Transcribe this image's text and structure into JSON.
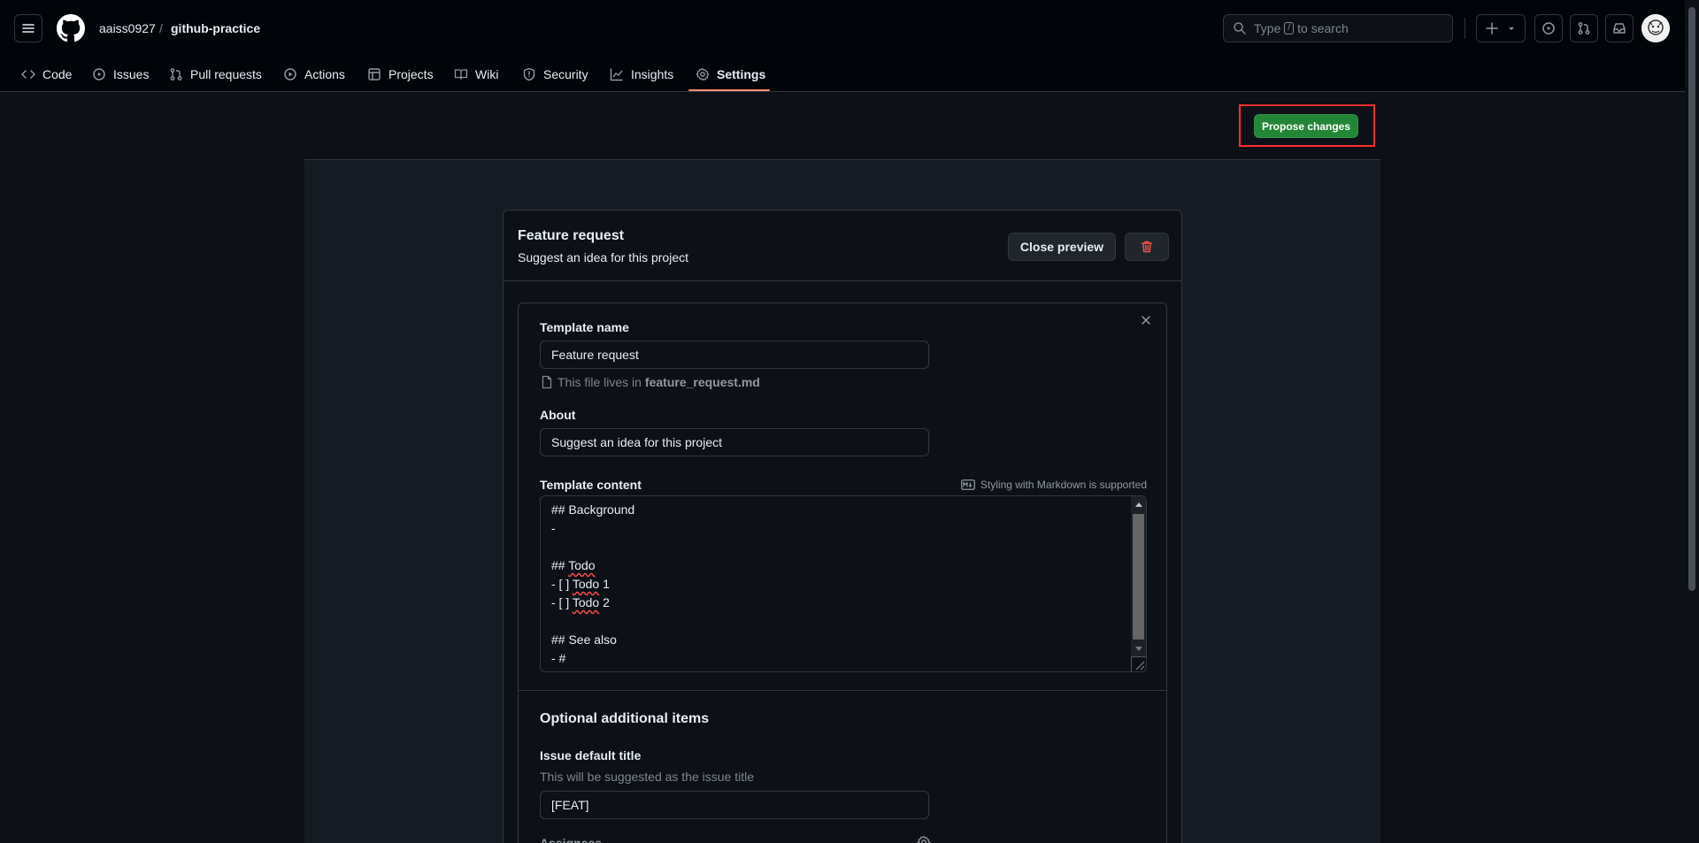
{
  "header": {
    "owner": "aaiss0927",
    "separator": "/",
    "repo": "github-practice",
    "search": {
      "before": "Type",
      "key": "/",
      "after": "to search"
    }
  },
  "nav_tabs": [
    {
      "label": "Code",
      "icon": "code-icon"
    },
    {
      "label": "Issues",
      "icon": "issue-opened-icon"
    },
    {
      "label": "Pull requests",
      "icon": "git-pull-request-icon"
    },
    {
      "label": "Actions",
      "icon": "play-icon"
    },
    {
      "label": "Projects",
      "icon": "table-icon"
    },
    {
      "label": "Wiki",
      "icon": "book-icon"
    },
    {
      "label": "Security",
      "icon": "shield-icon"
    },
    {
      "label": "Insights",
      "icon": "graph-icon"
    },
    {
      "label": "Settings",
      "icon": "gear-icon",
      "active": true
    }
  ],
  "toolbar": {
    "propose_label": "Propose changes"
  },
  "template_card": {
    "title": "Feature request",
    "description": "Suggest an idea for this project",
    "close_preview_label": "Close preview"
  },
  "form": {
    "template_name_label": "Template name",
    "template_name_value": "Feature request",
    "file_hint_prefix": "This file lives in",
    "file_name": "feature_request.md",
    "about_label": "About",
    "about_value": "Suggest an idea for this project",
    "content_label": "Template content",
    "markdown_hint": "Styling with Markdown is supported",
    "content_lines": [
      {
        "pre": "## Background",
        "sq": "",
        "post": ""
      },
      {
        "pre": "-",
        "sq": "",
        "post": ""
      },
      {
        "pre": "",
        "sq": "",
        "post": ""
      },
      {
        "pre": "## ",
        "sq": "Todo",
        "post": ""
      },
      {
        "pre": "- [ ] ",
        "sq": "Todo",
        "post": " 1"
      },
      {
        "pre": "- [ ] ",
        "sq": "Todo",
        "post": " 2"
      },
      {
        "pre": "",
        "sq": "",
        "post": ""
      },
      {
        "pre": "## See also",
        "sq": "",
        "post": ""
      },
      {
        "pre": "- #",
        "sq": "",
        "post": ""
      }
    ],
    "optional_title": "Optional additional items",
    "issue_title_label": "Issue default title",
    "issue_title_hint": "This will be suggested as the issue title",
    "issue_title_value": "[FEAT]",
    "assignees_label": "Assignees"
  },
  "colors": {
    "bg": "#0d1117",
    "header_bg": "#010409",
    "accent_underline": "#fd8c73",
    "primary_button": "#238636",
    "highlight_box": "#ff2d2d",
    "danger": "#f85149"
  }
}
